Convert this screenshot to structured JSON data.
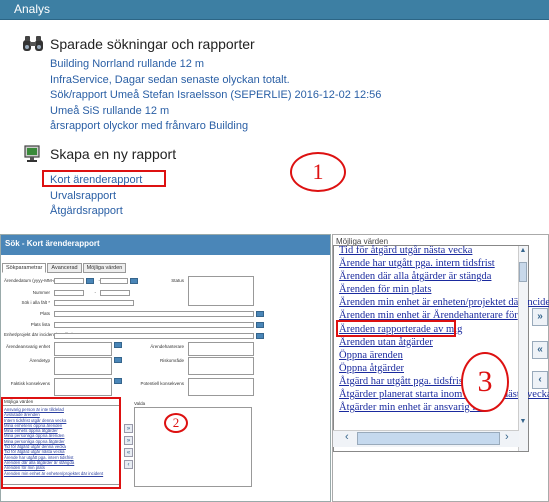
{
  "window": {
    "title": "Analys"
  },
  "saved": {
    "heading": "Sparade sökningar och rapporter",
    "items": [
      "Building Norrland rullande 12 m",
      "InfraService, Dagar sedan senaste olyckan totalt.",
      "Sök/rapport Umeå Stefan Israelsson (SEPERLIE) 2016-12-02 12:56",
      "Umeå SiS rullande 12 m",
      "årsrapport olyckor med frånvaro Building"
    ]
  },
  "new_report": {
    "heading": "Skapa en ny rapport",
    "items": [
      "Kort ärenderapport",
      "Urvalsrapport",
      "Åtgärdsrapport"
    ]
  },
  "annotations": {
    "one": "1",
    "two": "2",
    "three": "3"
  },
  "form": {
    "title": "Sök - Kort ärenderapport",
    "tabs": [
      "Sökparametrar",
      "Avancerad",
      "Möjliga värden"
    ],
    "labels": {
      "arendedatum": "Ärendedatum (yyyy-MM-dd)",
      "nummer": "Nummer",
      "sok_falt": "Sök i alla fält *",
      "plats": "Plats",
      "plats_lista": "Plats lista",
      "enhet_projekt": "Enhet/projekt där incident inträffade",
      "arendeansvarig": "Ärendeansvarig enhet",
      "arendetyp": "Ärendetyp",
      "faktisk": "Faktisk konsekvens",
      "status": "Status",
      "arendehanterare": "Ärendehanterare",
      "riskomrade": "Riskområde",
      "potentiell": "Potentiell konsekvens",
      "dash": "-",
      "mojliga": "Möjliga värden",
      "valda": "Valda"
    },
    "values_list": [
      "Ansvarig person är inte tilldelad",
      "Avslutade ärenden",
      "Intern tidsfrist utgår denna vecka",
      "Mina enhetens öppna ärenden",
      "Mina enhets öppna åtgärder",
      "Mina personliga öppna ärenden",
      "Mina personliga öppna åtgärder",
      "Tid för åtgärd utgår denna vecka",
      "Tid för åtgärd utgår nästa vecka",
      "Ärende har utgått pga. intern tidsfrist",
      "Ärenden där alla åtgärder är stängda",
      "Ärenden för min plats",
      "Ärenden min enhet är enheten/projektet där incident"
    ],
    "buttons": {
      "add": "»",
      "add_all": "»",
      "remove": "«",
      "remove_all": "‹"
    }
  },
  "zoom": {
    "heading": "Möjliga värden",
    "items": [
      "Tid för åtgärd utgår nästa vecka",
      "Ärende har utgått pga. intern tidsfrist",
      "Ärenden där alla åtgärder är stängda",
      "Ärenden för min plats",
      "Ärenden min enhet är enheten/projektet där incident",
      "Ärenden min enhet är Ärendehanterare för",
      "Ärenden rapporterade av mig",
      "Ärenden utan åtgärder",
      "Öppna ärenden",
      "Öppna åtgärder",
      "Åtgärd har utgått pga. tidsfrist",
      "Åtgärder planerat starta inom slutet av nästa vecka",
      "Åtgärder min enhet är ansvarig för"
    ],
    "scroll_left": "‹",
    "scroll_right": "›",
    "scroll_up": "▲",
    "scroll_down": "▼",
    "side_buttons": [
      "»",
      "«",
      "‹"
    ]
  },
  "colors": {
    "title_bar": "#3d7fa3",
    "link": "#2a5fa5",
    "annotation": "#dd1111"
  }
}
